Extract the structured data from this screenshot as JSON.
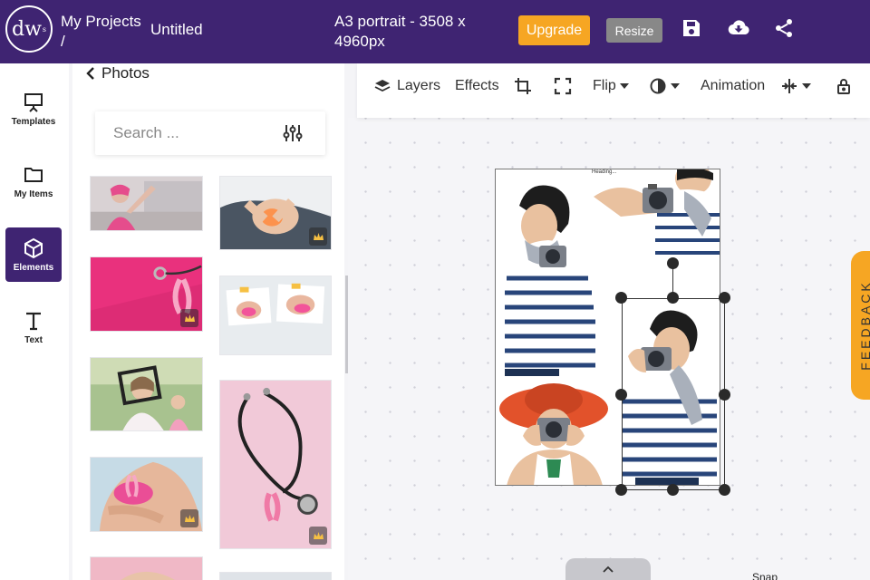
{
  "header": {
    "logo_text": "dw",
    "logo_mark": "s",
    "breadcrumb_line1": "My Projects",
    "breadcrumb_line2": "/",
    "doc_title": "Untitled",
    "doc_size_line1": "A3 portrait - 3508 x",
    "doc_size_line2": "4960px",
    "upgrade_label": "Upgrade",
    "resize_label": "Resize",
    "icons": [
      "save-icon",
      "cloud-download-icon",
      "share-icon"
    ]
  },
  "rail": {
    "items": [
      {
        "label": "Templates",
        "icon": "presentation-icon",
        "active": false
      },
      {
        "label": "My Items",
        "icon": "folder-icon",
        "active": false
      },
      {
        "label": "Elements",
        "icon": "cube-icon",
        "active": true
      },
      {
        "label": "Text",
        "icon": "text-icon",
        "active": false
      }
    ]
  },
  "panel": {
    "back_label": "Photos",
    "search_placeholder": "Search ...",
    "thumbnails": [
      {
        "subject": "woman with pink headscarf",
        "premium": false
      },
      {
        "subject": "knee pain",
        "premium": true
      },
      {
        "subject": "pink ribbon with stethoscope",
        "premium": true
      },
      {
        "subject": "breast self exam notes",
        "premium": false
      },
      {
        "subject": "woman with frame",
        "premium": false
      },
      {
        "subject": "woman in pink bra with ribbon",
        "premium": true
      },
      {
        "subject": "stethoscope on pink",
        "premium": true
      }
    ]
  },
  "toolbar": {
    "layers_label": "Layers",
    "effects_label": "Effects",
    "flip_label": "Flip",
    "animation_label": "Animation",
    "icons": [
      "layers-icon",
      "crop-icon",
      "fullscreen-icon",
      "contrast-icon",
      "spacing-icon",
      "lock-icon"
    ]
  },
  "canvas": {
    "heading_text": "Heading...",
    "selection_handles": 8
  },
  "feedback_label": "FEEDBACK",
  "snap_label": "Snap",
  "colors": {
    "brand": "#3f2472",
    "accent": "#f6a623",
    "resize": "#888888"
  }
}
